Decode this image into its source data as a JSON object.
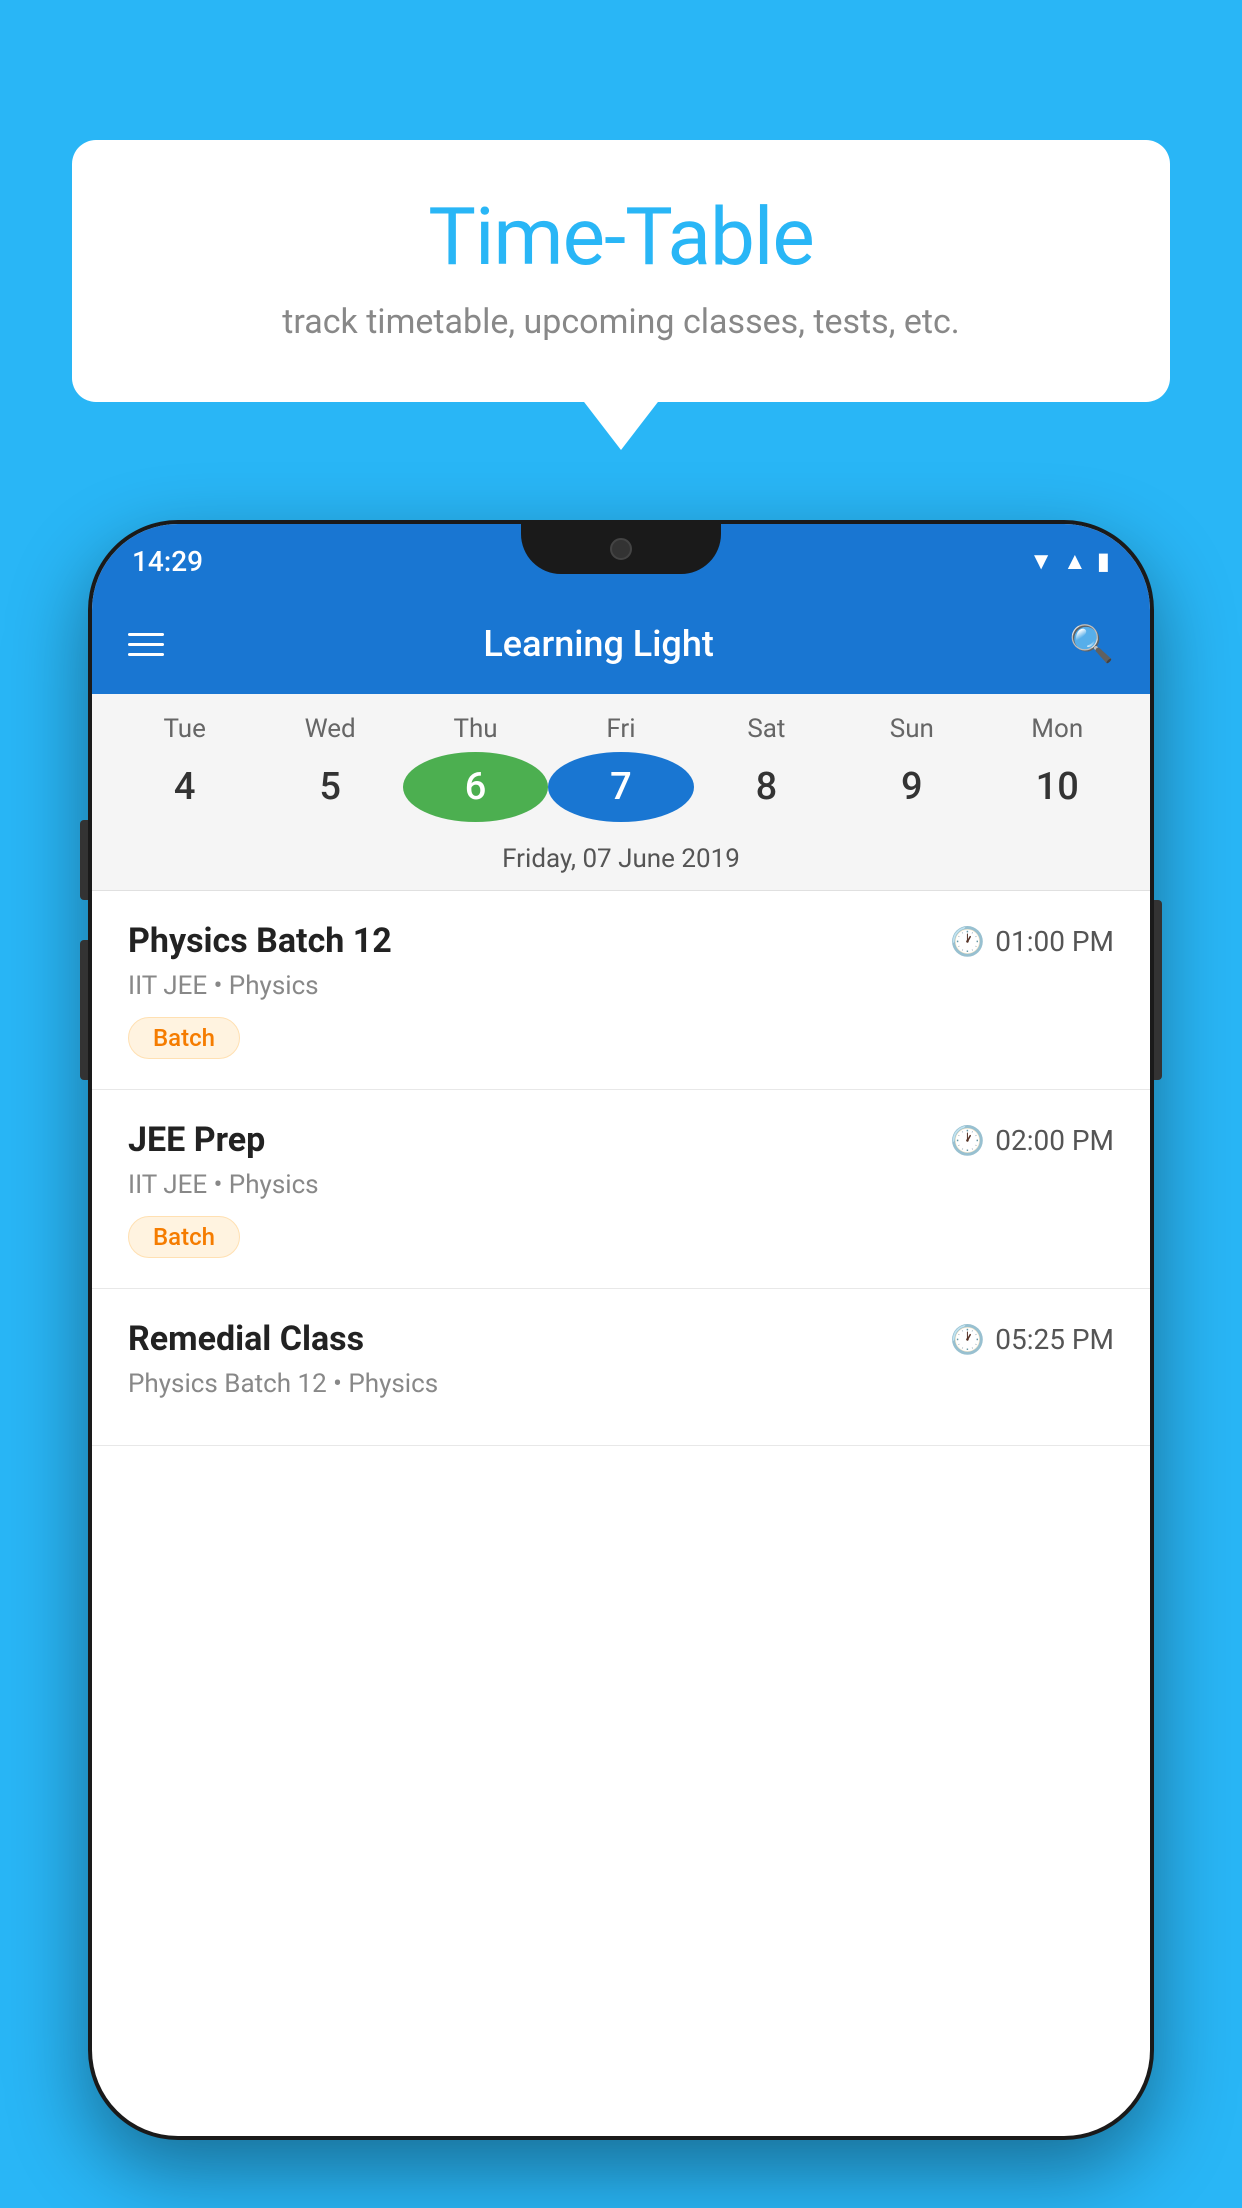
{
  "background_color": "#29B6F6",
  "bubble": {
    "title": "Time-Table",
    "subtitle": "track timetable, upcoming classes, tests, etc."
  },
  "phone": {
    "status_bar": {
      "time": "14:29"
    },
    "app_bar": {
      "title": "Learning Light"
    },
    "calendar": {
      "days": [
        {
          "short": "Tue",
          "num": "4"
        },
        {
          "short": "Wed",
          "num": "5"
        },
        {
          "short": "Thu",
          "num": "6",
          "state": "today"
        },
        {
          "short": "Fri",
          "num": "7",
          "state": "selected"
        },
        {
          "short": "Sat",
          "num": "8"
        },
        {
          "short": "Sun",
          "num": "9"
        },
        {
          "short": "Mon",
          "num": "10"
        }
      ],
      "selected_date": "Friday, 07 June 2019"
    },
    "schedule": [
      {
        "name": "Physics Batch 12",
        "time": "01:00 PM",
        "meta": "IIT JEE • Physics",
        "badge": "Batch"
      },
      {
        "name": "JEE Prep",
        "time": "02:00 PM",
        "meta": "IIT JEE • Physics",
        "badge": "Batch"
      },
      {
        "name": "Remedial Class",
        "time": "05:25 PM",
        "meta": "Physics Batch 12 • Physics",
        "badge": null
      }
    ]
  }
}
